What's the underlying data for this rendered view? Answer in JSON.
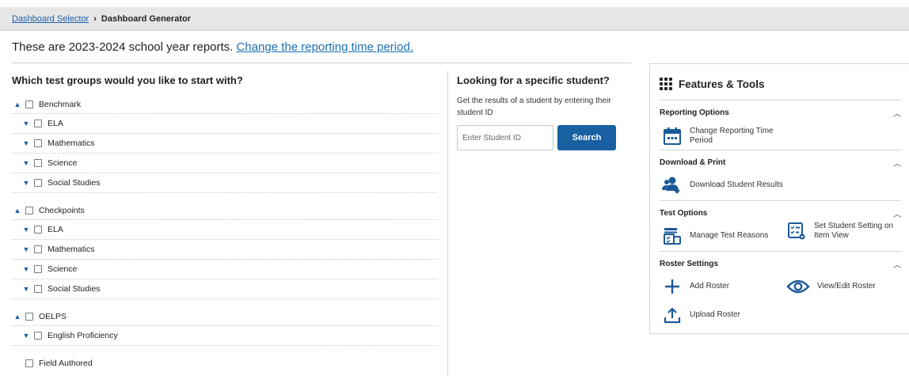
{
  "breadcrumb": {
    "parent": "Dashboard Selector",
    "separator": "›",
    "current": "Dashboard Generator"
  },
  "period": {
    "text": "These are 2023-2024 school year reports.",
    "link": "Change the reporting time period."
  },
  "groups": {
    "title": "Which test groups would you like to start with?",
    "rows": [
      {
        "level": "top",
        "label": "Benchmark",
        "chev": "up"
      },
      {
        "level": "sub",
        "label": "ELA",
        "chev": "down"
      },
      {
        "level": "sub",
        "label": "Mathematics",
        "chev": "down"
      },
      {
        "level": "sub",
        "label": "Science",
        "chev": "down"
      },
      {
        "level": "sub",
        "label": "Social Studies",
        "chev": "down"
      },
      {
        "level": "top",
        "label": "Checkpoints",
        "chev": "up"
      },
      {
        "level": "sub",
        "label": "ELA",
        "chev": "down"
      },
      {
        "level": "sub",
        "label": "Mathematics",
        "chev": "down"
      },
      {
        "level": "sub",
        "label": "Science",
        "chev": "down"
      },
      {
        "level": "sub",
        "label": "Social Studies",
        "chev": "down"
      },
      {
        "level": "top",
        "label": "OELPS",
        "chev": "up"
      },
      {
        "level": "sub",
        "label": "English Proficiency",
        "chev": "down"
      },
      {
        "level": "top",
        "label": "Field Authored",
        "chev": "none"
      }
    ]
  },
  "student": {
    "title": "Looking for a specific student?",
    "description": "Get the results of a student by entering their student ID",
    "placeholder": "Enter Student ID",
    "button": "Search"
  },
  "features": {
    "title": "Features & Tools",
    "sections": [
      {
        "title": "Reporting Options",
        "tools": [
          {
            "label": "Change Reporting Time Period",
            "icon": "calendar-icon"
          }
        ]
      },
      {
        "title": "Download & Print",
        "tools": [
          {
            "label": "Download Student Results",
            "icon": "download-students-icon"
          }
        ]
      },
      {
        "title": "Test Options",
        "tools": [
          {
            "label": "Manage Test Reasons",
            "icon": "manage-test-reasons-icon"
          },
          {
            "label": "Set Student Setting on Item View",
            "icon": "student-setting-icon"
          }
        ]
      },
      {
        "title": "Roster Settings",
        "tools": [
          {
            "label": "Add Roster",
            "icon": "plus-icon"
          },
          {
            "label": "View/Edit Roster",
            "icon": "eye-icon"
          },
          {
            "label": "Upload Roster",
            "icon": "upload-icon"
          }
        ]
      }
    ]
  },
  "colors": {
    "link": "#1b5fa8",
    "button": "#1860a0",
    "icon": "#1b5a99"
  }
}
